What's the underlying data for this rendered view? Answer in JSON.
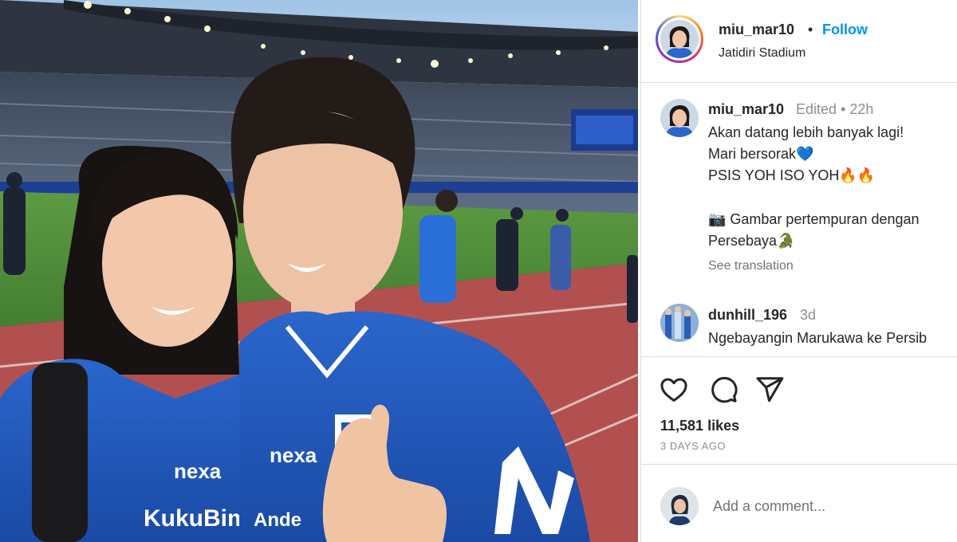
{
  "post": {
    "username": "miu_mar10",
    "follow_label": "Follow",
    "separator": "•",
    "location": "Jatidiri Stadium"
  },
  "caption": {
    "username": "miu_mar10",
    "meta": "Edited • 22h",
    "lines": [
      "Akan datang lebih banyak lagi!",
      "Mari bersorak💙",
      "PSIS YOH ISO YOH🔥🔥",
      "📷 Gambar pertempuran dengan",
      "Persebaya🐊"
    ],
    "see_translation": "See translation"
  },
  "comment": {
    "username": "dunhill_196",
    "time": "3d",
    "text": "Ngebayangin Marukawa ke Persib"
  },
  "actions": {
    "like_icon": "heart-icon",
    "comment_icon": "comment-bubble-icon",
    "share_icon": "paper-plane-icon",
    "likes": "11,581 likes",
    "date": "3 DAYS AGO"
  },
  "add_comment": {
    "placeholder": "Add a comment..."
  },
  "photo": {
    "jersey_sponsor": "nexa",
    "jersey_text_1": "KukuBima",
    "jersey_text_2": "Ande"
  },
  "colors": {
    "accent": "#0095f6",
    "jersey_blue": "#1f55b8",
    "pitch_green": "#4f8f3a",
    "track_red": "#b25050"
  }
}
